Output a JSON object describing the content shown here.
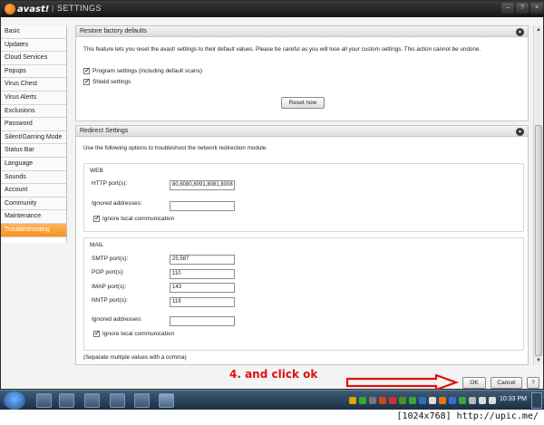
{
  "window": {
    "brand": "avast!",
    "title": "SETTINGS",
    "controls": [
      "–",
      "?",
      "×"
    ]
  },
  "sidebar": {
    "items": [
      {
        "label": "Basic"
      },
      {
        "label": "Updates"
      },
      {
        "label": "Cloud Services"
      },
      {
        "label": "Popups"
      },
      {
        "label": "Virus Chest"
      },
      {
        "label": "Virus Alerts"
      },
      {
        "label": "Exclusions"
      },
      {
        "label": "Password"
      },
      {
        "label": "Silent/Gaming Mode"
      },
      {
        "label": "Status Bar"
      },
      {
        "label": "Language"
      },
      {
        "label": "Sounds"
      },
      {
        "label": "Account"
      },
      {
        "label": "Community"
      },
      {
        "label": "Maintenance"
      },
      {
        "label": "Troubleshooting",
        "active": true
      }
    ]
  },
  "restore": {
    "title": "Restore factory defaults",
    "description": "This feature lets you reset the avast! settings to their default values. Please be careful as you will lose all your custom settings. This action cannot be undone.",
    "program_settings_label": "Program settings (including default scans)",
    "program_settings_checked": true,
    "shield_settings_label": "Shield settings",
    "shield_settings_checked": true,
    "reset_button": "Reset now"
  },
  "redirect": {
    "title": "Redirect Settings",
    "description": "Use the following options to troubleshoot the network redirection module.",
    "web": {
      "title": "WEB",
      "http_label": "HTTP port(s):",
      "http_value": "80,8080,8091,8081,8008",
      "ignored_label": "Ignored addresses:",
      "ignored_value": "",
      "ignore_local_label": "Ignore local communication",
      "ignore_local_checked": true
    },
    "mail": {
      "title": "MAIL",
      "smtp_label": "SMTP port(s):",
      "smtp_value": "25,587",
      "pop_label": "POP port(s):",
      "pop_value": "110",
      "imap_label": "IMAP port(s):",
      "imap_value": "143",
      "nntp_label": "NNTP port(s):",
      "nntp_value": "119",
      "ignored_label": "Ignored addresses:",
      "ignored_value": "",
      "ignore_local_label": "Ignore local communication",
      "ignore_local_checked": true
    },
    "note": "(Separate multiple values with a comma)"
  },
  "footer": {
    "annotation": "4. and click ok",
    "ok_button": "OK",
    "cancel_button": "Cancel",
    "help_button": "?"
  },
  "taskbar": {
    "clock": "10:33 PM"
  },
  "watermark": "[1024x768] http://upic.me/",
  "colors": {
    "accent": "#f7931e",
    "annotation": "#e01010",
    "titlebar": "#1a1a1a"
  }
}
